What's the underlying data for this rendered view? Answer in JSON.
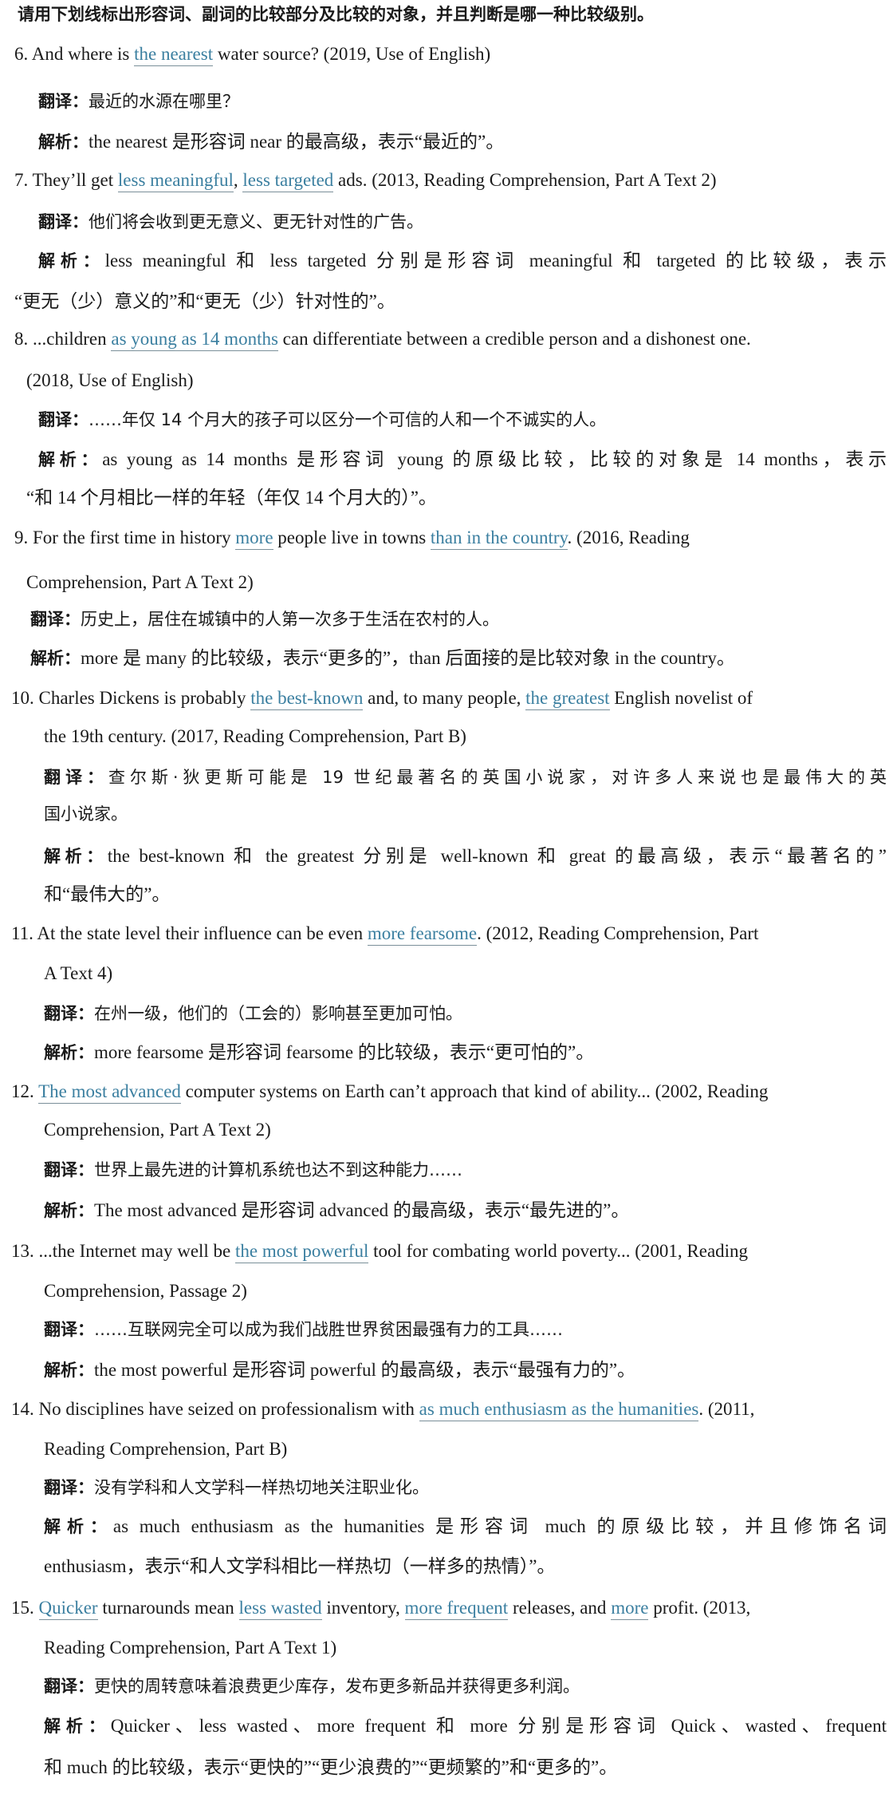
{
  "instruction": "请用下划线标出形容词、副词的比较部分及比较的对象，并且判断是哪一种比较级别。",
  "items": [
    {
      "num": "6.",
      "q": [
        {
          "t": "And where is "
        },
        {
          "t": "the nearest",
          "u": true
        },
        {
          "t": " water source? (2019, Use of English)"
        }
      ],
      "translation_label": "翻译：",
      "translation": [
        "最近的水源在哪里？"
      ],
      "analysis_label": "解析：",
      "analysis": [
        "the nearest 是形容词 near 的最高级，表示“最近的”。"
      ]
    },
    {
      "num": "7.",
      "q": [
        {
          "t": "They’ll get "
        },
        {
          "t": "less meaningful",
          "u": true
        },
        {
          "t": ", "
        },
        {
          "t": "less targeted",
          "u": true
        },
        {
          "t": " ads. (2013, Reading Comprehension, Part A Text 2)"
        }
      ],
      "translation_label": "翻译：",
      "translation": [
        "他们将会收到更无意义、更无针对性的广告。"
      ],
      "analysis_label": "解析：",
      "analysis": [
        "less meaningful 和 less targeted 分别是形容词 meaningful 和 targeted 的比较级，表示",
        "“更无（少）意义的”和“更无（少）针对性的”。"
      ]
    },
    {
      "num": "8.",
      "q": [
        {
          "t": "...children "
        },
        {
          "t": "as young as 14 months",
          "u": true
        },
        {
          "t": " can differentiate between a credible person and a dishonest one."
        }
      ],
      "q2": "(2018, Use of English)",
      "translation_label": "翻译：",
      "translation": [
        "……年仅 14 个月大的孩子可以区分一个可信的人和一个不诚实的人。"
      ],
      "analysis_label": "解析：",
      "analysis": [
        "as young as 14 months 是形容词 young 的原级比较，比较的对象是 14 months，表示",
        "“和 14 个月相比一样的年轻（年仅 14 个月大的）”。"
      ]
    },
    {
      "num": "9.",
      "q": [
        {
          "t": "For the first time in history "
        },
        {
          "t": "more",
          "u": true
        },
        {
          "t": " people live in towns "
        },
        {
          "t": "than in the country",
          "u": true
        },
        {
          "t": ". (2016, Reading"
        }
      ],
      "q2": "Comprehension, Part A Text 2)",
      "translation_label": "翻译：",
      "translation": [
        "历史上，居住在城镇中的人第一次多于生活在农村的人。"
      ],
      "analysis_label": "解析：",
      "analysis": [
        "more 是 many 的比较级，表示“更多的”，than 后面接的是比较对象 in the country。"
      ]
    },
    {
      "num": "10.",
      "q": [
        {
          "t": "Charles Dickens is probably "
        },
        {
          "t": "the best-known",
          "u": true
        },
        {
          "t": " and, to many people, "
        },
        {
          "t": "the greatest",
          "u": true
        },
        {
          "t": " English novelist of"
        }
      ],
      "q2": "the 19th century. (2017, Reading Comprehension, Part B)",
      "translation_label": "翻译：",
      "translation": [
        "查尔斯·狄更斯可能是 19 世纪最著名的英国小说家，对许多人来说也是最伟大的英",
        "国小说家。"
      ],
      "analysis_label": "解析：",
      "analysis": [
        "the best-known 和 the greatest 分别是 well-known 和 great 的最高级，表示“最著名的”",
        "和“最伟大的”。"
      ]
    },
    {
      "num": "11.",
      "q": [
        {
          "t": "At the state level their influence can be even "
        },
        {
          "t": "more fearsome",
          "u": true
        },
        {
          "t": ". (2012, Reading Comprehension, Part"
        }
      ],
      "q2": "A Text 4)",
      "translation_label": "翻译：",
      "translation": [
        "在州一级，他们的（工会的）影响甚至更加可怕。"
      ],
      "analysis_label": "解析：",
      "analysis": [
        "more fearsome 是形容词 fearsome 的比较级，表示“更可怕的”。"
      ]
    },
    {
      "num": "12.",
      "q": [
        {
          "t": "The most advanced",
          "u": true
        },
        {
          "t": " computer systems on Earth can’t approach that kind of ability... (2002, Reading"
        }
      ],
      "q2": "Comprehension, Part A Text 2)",
      "translation_label": "翻译：",
      "translation": [
        "世界上最先进的计算机系统也达不到这种能力……"
      ],
      "analysis_label": "解析：",
      "analysis": [
        "The most advanced 是形容词 advanced 的最高级，表示“最先进的”。"
      ]
    },
    {
      "num": "13.",
      "q": [
        {
          "t": "...the Internet may well be "
        },
        {
          "t": "the most powerful",
          "u": true
        },
        {
          "t": " tool for combating world poverty... (2001, Reading"
        }
      ],
      "q2": "Comprehension, Passage 2)",
      "translation_label": "翻译：",
      "translation": [
        "……互联网完全可以成为我们战胜世界贫困最强有力的工具……"
      ],
      "analysis_label": "解析：",
      "analysis": [
        "the most powerful 是形容词 powerful 的最高级，表示“最强有力的”。"
      ]
    },
    {
      "num": "14.",
      "q": [
        {
          "t": "No disciplines have seized on professionalism with "
        },
        {
          "t": "as much enthusiasm as the humanities",
          "u": true
        },
        {
          "t": ". (2011,"
        }
      ],
      "q2": "Reading Comprehension, Part B)",
      "translation_label": "翻译：",
      "translation": [
        "没有学科和人文学科一样热切地关注职业化。"
      ],
      "analysis_label": "解析：",
      "analysis": [
        "as much enthusiasm as the humanities 是形容词 much 的原级比较，并且修饰名词",
        "enthusiasm，表示“和人文学科相比一样热切（一样多的热情）”。"
      ]
    },
    {
      "num": "15.",
      "q": [
        {
          "t": "Quicker",
          "u": true
        },
        {
          "t": " turnarounds mean "
        },
        {
          "t": "less wasted",
          "u": true
        },
        {
          "t": " inventory, "
        },
        {
          "t": "more frequent",
          "u": true
        },
        {
          "t": " releases, and "
        },
        {
          "t": "more",
          "u": true
        },
        {
          "t": " profit. (2013,"
        }
      ],
      "q2": "Reading Comprehension, Part A Text 1)",
      "translation_label": "翻译：",
      "translation": [
        "更快的周转意味着浪费更少库存，发布更多新品并获得更多利润。"
      ],
      "analysis_label": "解析：",
      "analysis": [
        "Quicker、less wasted、more frequent 和 more 分别是形容词 Quick、wasted、frequent",
        "和 much 的比较级，表示“更快的”“更少浪费的”“更频繁的”和“更多的”。"
      ]
    }
  ]
}
